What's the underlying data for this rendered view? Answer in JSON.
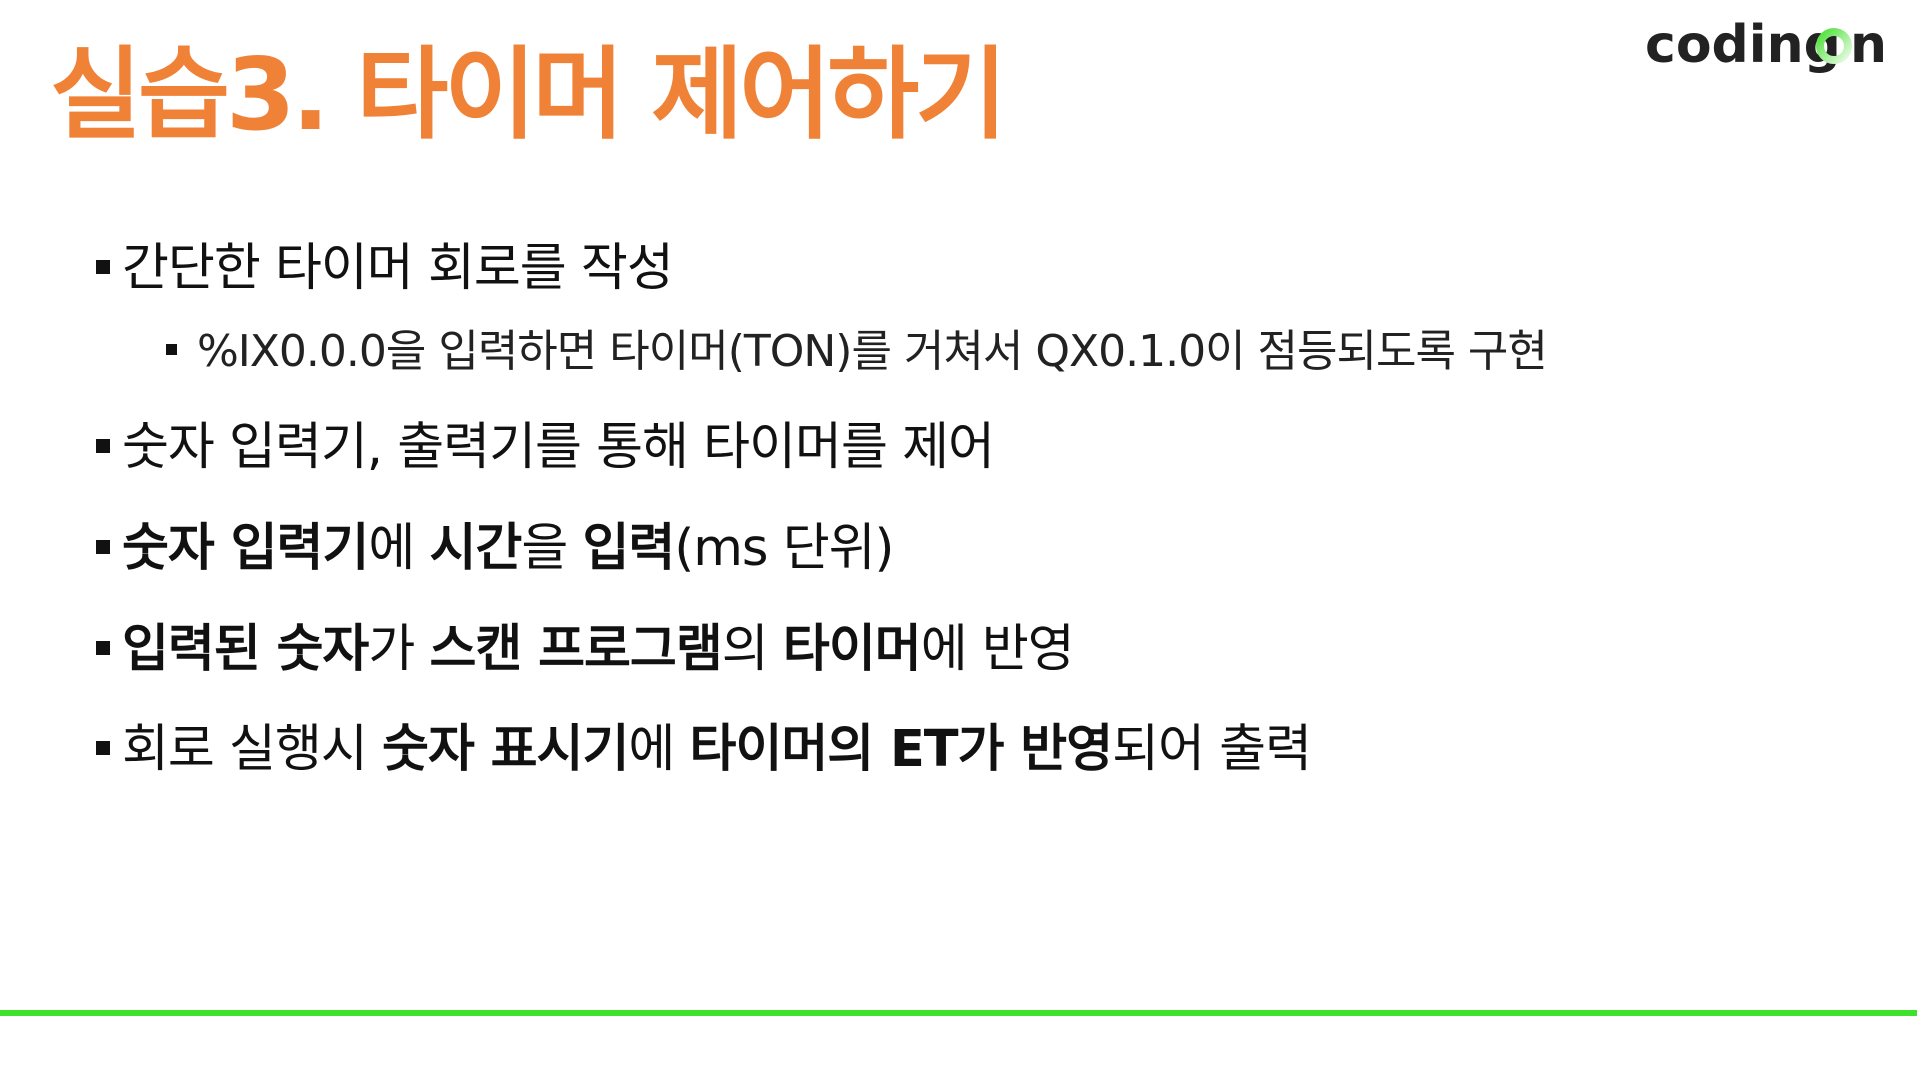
{
  "title": "실습3. 타이머 제어하기",
  "logo": {
    "before": "coding",
    "after": "n",
    "ring_gradient": [
      "#4fe03a",
      "#ffffff"
    ]
  },
  "accent_color": "#F08238",
  "rule_color": "#3ee12b",
  "bullets": {
    "b1": "간단한 타이머 회로를 작성",
    "b1_1": "%IX0.0.0을 입력하면 타이머(TON)를 거쳐서 QX0.1.0이 점등되도록 구현",
    "b2": "숫자 입력기, 출력기를 통해 타이머를 제어",
    "b3": {
      "s1": "숫자 입력기",
      "s2": "에 ",
      "s3": "시간",
      "s4": "을 ",
      "s5": "입력",
      "s6": "(ms 단위)"
    },
    "b4": {
      "s1": "입력된 숫자",
      "s2": "가 ",
      "s3": "스캔 프로그램",
      "s4": "의 ",
      "s5": "타이머",
      "s6": "에 반영"
    },
    "b5": {
      "s1": "회로 실행시 ",
      "s2": "숫자 표시기",
      "s3": "에 ",
      "s4": "타이머의 ET가 반영",
      "s5": "되어 출력"
    }
  }
}
